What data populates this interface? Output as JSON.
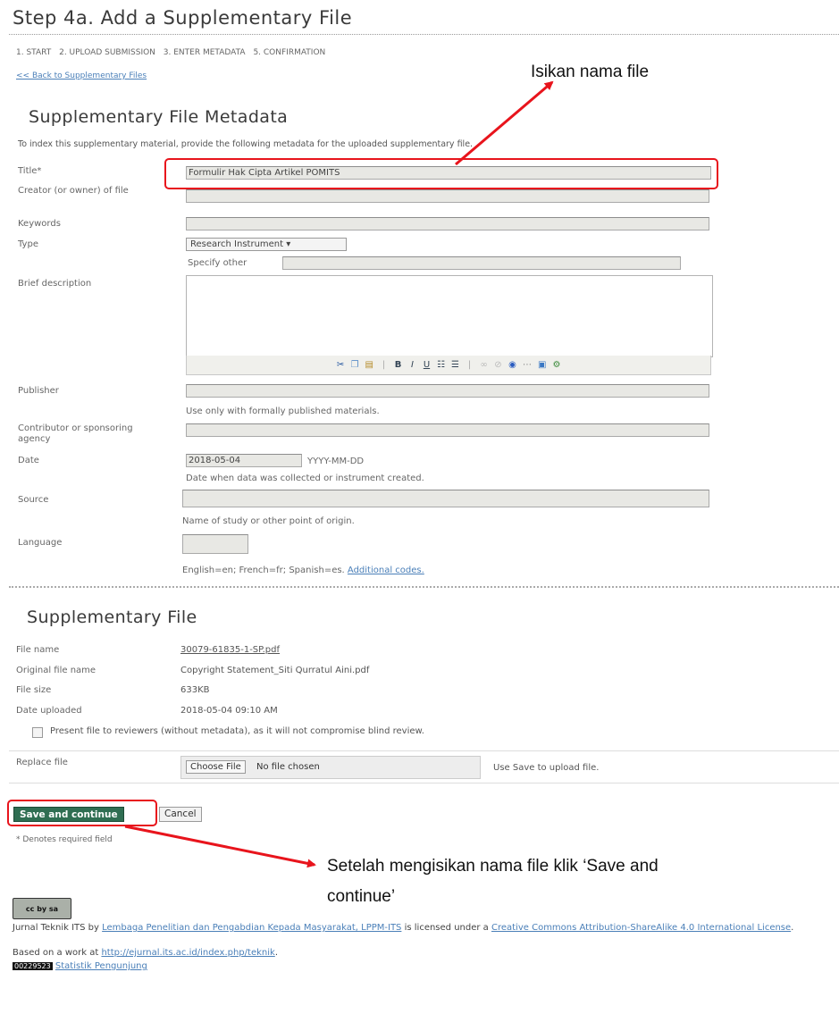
{
  "page_title": "Step 4a. Add a Supplementary File",
  "steps": [
    "1. START",
    "2. UPLOAD SUBMISSION",
    "3. ENTER METADATA",
    "5. CONFIRMATION"
  ],
  "back_link": "<< Back to Supplementary Files",
  "metadata_heading": "Supplementary File Metadata",
  "intro": "To index this supplementary material, provide the following metadata for the uploaded supplementary file.",
  "fields": {
    "title_label": "Title*",
    "title_value": "Formulir Hak Cipta Artikel POMITS",
    "creator_label": "Creator (or owner) of file",
    "creator_value": "",
    "keywords_label": "Keywords",
    "keywords_value": "",
    "type_label": "Type",
    "type_selected": "Research Instrument",
    "specify_other_label": "Specify other",
    "specify_other_value": "",
    "description_label": "Brief description",
    "description_value": "",
    "publisher_label": "Publisher",
    "publisher_value": "",
    "publisher_hint": "Use only with formally published materials.",
    "contributor_label": "Contributor or sponsoring agency",
    "contributor_value": "",
    "date_label": "Date",
    "date_value": "2018-05-04",
    "date_format": "YYYY-MM-DD",
    "date_hint": "Date when data was collected or instrument created.",
    "source_label": "Source",
    "source_value": "",
    "source_hint": "Name of study or other point of origin.",
    "language_label": "Language",
    "language_value": "",
    "language_hint": "English=en; French=fr; Spanish=es.",
    "language_link": "Additional codes."
  },
  "editor_toolbar": [
    "cut",
    "copy",
    "paste",
    "|",
    "B",
    "I",
    "U",
    "ordered-list",
    "unordered-list",
    "|",
    "link",
    "unlink",
    "html",
    "more",
    "image",
    "tools"
  ],
  "file_section": {
    "heading": "Supplementary File",
    "file_name_label": "File name",
    "file_name_value": "30079-61835-1-SP.pdf",
    "original_label": "Original file name",
    "original_value": "Copyright Statement_Siti Qurratul Aini.pdf",
    "size_label": "File size",
    "size_value": "633KB",
    "uploaded_label": "Date uploaded",
    "uploaded_value": "2018-05-04 09:10 AM",
    "present_checkbox": "Present file to reviewers (without metadata), as it will not compromise blind review.",
    "replace_label": "Replace file",
    "choose_file_button": "Choose File",
    "no_file": "No file chosen",
    "save_hint": "Use Save to upload file."
  },
  "buttons": {
    "save": "Save and continue",
    "cancel": "Cancel"
  },
  "required_note": "* Denotes required field",
  "annotations": {
    "fill_name": "Isikan nama file",
    "after_fill": "Setelah mengisikan nama file klik ‘Save and continue’"
  },
  "footer": {
    "cc_badge": "cc by sa",
    "journal_text": "Jurnal Teknik ITS by",
    "org_link": "Lembaga Penelitian dan Pengabdian Kepada Masyarakat, LPPM-ITS",
    "licensed_text": "is licensed under a",
    "license_link": "Creative Commons Attribution-ShareAlike 4.0 International License",
    "based_text": "Based on a work at",
    "based_link": "http://ejurnal.its.ac.id/index.php/teknik",
    "counter": "00229523",
    "stats_link": "Statistik Pengunjung"
  },
  "colors": {
    "annotation_red": "#e8141c",
    "link": "#4a7fb8",
    "save_button": "#2f6e52"
  }
}
